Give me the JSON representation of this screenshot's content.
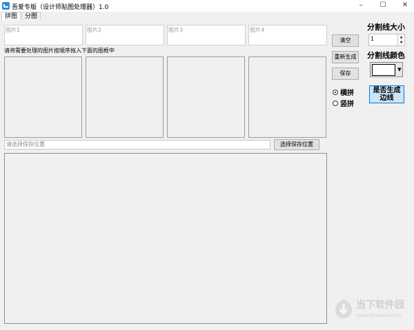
{
  "window": {
    "title": "吾爱专版（设计师贴图处理器）1.0",
    "minimize": "–",
    "maximize": "☐",
    "close": "✕"
  },
  "tabs": [
    {
      "label": "拼图",
      "active": true
    },
    {
      "label": "分图",
      "active": false
    }
  ],
  "image_fields": [
    "图片1",
    "图片2",
    "图片3",
    "图片4"
  ],
  "instruction": "请将需要处理的图片按顺序拖入下面的图框中",
  "buttons": {
    "clear": "清空",
    "regenerate": "重新生成",
    "save": "保存",
    "choose_save_location": "选择保存位置"
  },
  "orientation": {
    "horizontal": "横拼",
    "vertical": "竖拼",
    "selected": "horizontal"
  },
  "save_path_placeholder": "请选择保存位置",
  "side": {
    "divider_size_label": "分割线大小",
    "divider_size_value": "1",
    "divider_color_label": "分割线颜色",
    "divider_color": "#ffffff",
    "generate_border_label_line1": "是否生成",
    "generate_border_label_line2": "边线"
  },
  "watermark": {
    "name": "当下软件园",
    "url": "www.downxia.com"
  }
}
